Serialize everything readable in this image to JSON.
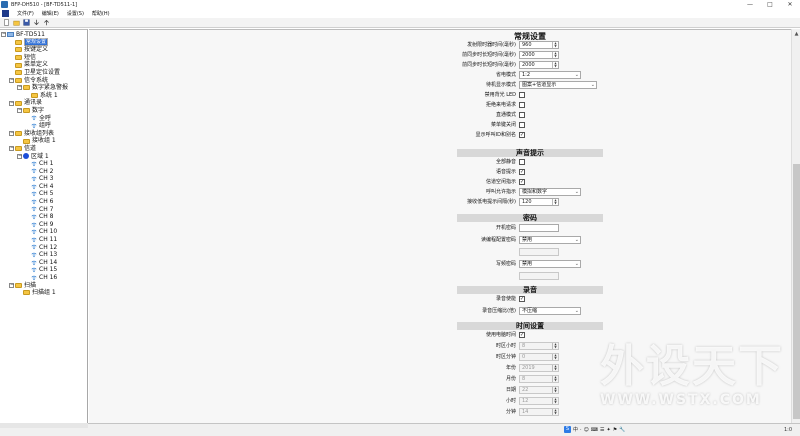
{
  "window": {
    "title": "BFP-DH510 - [BF-TD511-1]",
    "controls": [
      "—",
      "□",
      "✕"
    ]
  },
  "menu": {
    "items": [
      "文件(F)",
      "编辑(E)",
      "设置(S)",
      "帮助(H)"
    ]
  },
  "toolbar": {
    "buttons": [
      "new-icon",
      "open-icon",
      "save-icon",
      "read-icon",
      "write-icon"
    ]
  },
  "tree": {
    "nodes": [
      {
        "label": "BF-TD511",
        "level": 0,
        "kind": "pc"
      },
      {
        "label": "常规设置",
        "level": 1,
        "kind": "folder",
        "selected": true
      },
      {
        "label": "按键定义",
        "level": 1,
        "kind": "folder"
      },
      {
        "label": "短信",
        "level": 1,
        "kind": "folder"
      },
      {
        "label": "菜单定义",
        "level": 1,
        "kind": "folder"
      },
      {
        "label": "卫星定位设置",
        "level": 1,
        "kind": "folder"
      },
      {
        "label": "信令系统",
        "level": 1,
        "kind": "folder"
      },
      {
        "label": "数字紧急警报",
        "level": 2,
        "kind": "folder"
      },
      {
        "label": "系统 1",
        "level": 3,
        "kind": "folder"
      },
      {
        "label": "通讯录",
        "level": 1,
        "kind": "folder"
      },
      {
        "label": "数字",
        "level": 2,
        "kind": "folder"
      },
      {
        "label": "全呼",
        "level": 3,
        "kind": "signal"
      },
      {
        "label": "组呼",
        "level": 3,
        "kind": "signal"
      },
      {
        "label": "接收组列表",
        "level": 1,
        "kind": "folder"
      },
      {
        "label": "接收组 1",
        "level": 2,
        "kind": "folder"
      },
      {
        "label": "信道",
        "level": 1,
        "kind": "folder"
      },
      {
        "label": "区域 1",
        "level": 2,
        "kind": "zone"
      },
      {
        "label": "CH 1",
        "level": 3,
        "kind": "signal"
      },
      {
        "label": "CH 2",
        "level": 3,
        "kind": "signal"
      },
      {
        "label": "CH 3",
        "level": 3,
        "kind": "signal"
      },
      {
        "label": "CH 4",
        "level": 3,
        "kind": "signal"
      },
      {
        "label": "CH 5",
        "level": 3,
        "kind": "signal"
      },
      {
        "label": "CH 6",
        "level": 3,
        "kind": "signal"
      },
      {
        "label": "CH 7",
        "level": 3,
        "kind": "signal"
      },
      {
        "label": "CH 8",
        "level": 3,
        "kind": "signal"
      },
      {
        "label": "CH 9",
        "level": 3,
        "kind": "signal"
      },
      {
        "label": "CH 10",
        "level": 3,
        "kind": "signal"
      },
      {
        "label": "CH 11",
        "level": 3,
        "kind": "signal"
      },
      {
        "label": "CH 12",
        "level": 3,
        "kind": "signal"
      },
      {
        "label": "CH 13",
        "level": 3,
        "kind": "signal"
      },
      {
        "label": "CH 14",
        "level": 3,
        "kind": "signal"
      },
      {
        "label": "CH 15",
        "level": 3,
        "kind": "signal"
      },
      {
        "label": "CH 16",
        "level": 3,
        "kind": "signal"
      },
      {
        "label": "扫描",
        "level": 1,
        "kind": "folder"
      },
      {
        "label": "扫描组 1",
        "level": 2,
        "kind": "folder"
      }
    ]
  },
  "sections": {
    "general": "常规设置",
    "sound": "声音提示",
    "password": "密码",
    "record": "录音",
    "time": "时间设置"
  },
  "general": {
    "rows": [
      {
        "label": "发射限时器时间(毫秒)",
        "type": "spin",
        "value": "960"
      },
      {
        "label": "前同步时长短时间(毫秒)",
        "type": "spin",
        "value": "2000"
      },
      {
        "label": "前同步时长短时间(毫秒)",
        "type": "spin",
        "value": "2000"
      },
      {
        "label": "省电模式",
        "type": "select",
        "value": "1:2"
      },
      {
        "label": "待机显示模式",
        "type": "select",
        "value": "图案+信道显示",
        "wide": true
      },
      {
        "label": "禁用背光 LED",
        "type": "check",
        "value": ""
      },
      {
        "label": "拒绝来电请求",
        "type": "check",
        "value": ""
      },
      {
        "label": "直通模式",
        "type": "check",
        "value": ""
      },
      {
        "label": "菜单键关闭",
        "type": "check",
        "value": ""
      },
      {
        "label": "显示呼叫ID和别名",
        "type": "check",
        "value": "✓"
      }
    ]
  },
  "sound": {
    "rows": [
      {
        "label": "全部静音",
        "type": "check",
        "value": ""
      },
      {
        "label": "语音提示",
        "type": "check",
        "value": "✓"
      },
      {
        "label": "信道空闲指示",
        "type": "check",
        "value": "✓"
      },
      {
        "label": "呼叫允许指示",
        "type": "select",
        "value": "模拟和数字"
      },
      {
        "label": "接收低电提示间隔(秒)",
        "type": "spin",
        "value": "120"
      }
    ]
  },
  "password": {
    "rows": [
      {
        "label": "开机密码",
        "type": "text",
        "value": ""
      },
      {
        "label": "读编程配置密码",
        "type": "select",
        "value": "禁用"
      },
      {
        "label": "",
        "type": "text-dis",
        "value": ""
      },
      {
        "label": "写频密码",
        "type": "select",
        "value": "禁用"
      },
      {
        "label": "",
        "type": "text-dis",
        "value": ""
      }
    ]
  },
  "record": {
    "rows": [
      {
        "label": "录音使能",
        "type": "check",
        "value": "✓"
      },
      {
        "label": "录音压缩比(倍)",
        "type": "select",
        "value": "不压缩"
      }
    ]
  },
  "time": {
    "rows": [
      {
        "label": "使用电脑时间",
        "type": "check",
        "value": "✓"
      },
      {
        "label": "时区小时",
        "type": "spin-dis",
        "value": "8"
      },
      {
        "label": "时区分钟",
        "type": "spin-dis",
        "value": "0"
      },
      {
        "label": "年份",
        "type": "spin-dis",
        "value": "2019"
      },
      {
        "label": "月份",
        "type": "spin-dis",
        "value": "8"
      },
      {
        "label": "日期",
        "type": "spin-dis",
        "value": "22"
      },
      {
        "label": "小时",
        "type": "spin-dis",
        "value": "12"
      },
      {
        "label": "分钟",
        "type": "spin-dis",
        "value": "14"
      }
    ]
  },
  "status": {
    "right": "1:0",
    "ime": [
      "S",
      "中",
      "·",
      "☺",
      "⌨",
      "☰",
      "✦",
      "⚑",
      "🔧"
    ]
  },
  "watermark": {
    "big": "外设天下",
    "small": "WWW.WSTX.COM"
  },
  "colors": {
    "selection": "#2f6fd6",
    "section_bg": "#d8d8d8",
    "folder": "#f5c542"
  }
}
